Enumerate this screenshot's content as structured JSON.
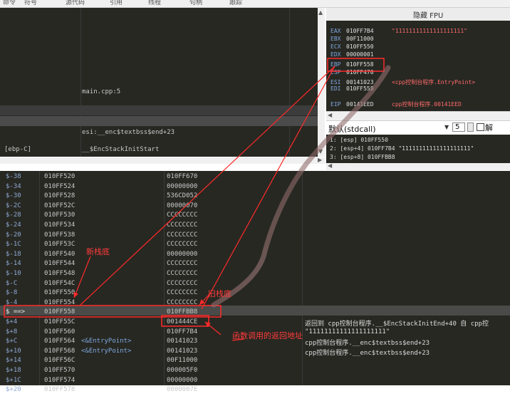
{
  "menubar": [
    "命令",
    "符号",
    "源代码",
    "引用",
    "线程",
    "句柄",
    "跟踪"
  ],
  "disasm": {
    "lines": [
      {
        "col": "",
        "text": "main.cpp:5"
      },
      {
        "col": "",
        "text": "esi:__enc$textbss$end+23"
      },
      {
        "col": "[ebp-C]",
        "text": "__$EncStackInitStart"
      }
    ]
  },
  "registers": {
    "title": "隐藏 FPU",
    "rows": [
      {
        "name": "EAX",
        "value": "010FF7B4",
        "comment": "\"11111111111111111111\""
      },
      {
        "name": "EBX",
        "value": "00F11000",
        "comment": ""
      },
      {
        "name": "ECX",
        "value": "010FF550",
        "comment": ""
      },
      {
        "name": "EDX",
        "value": "00000001",
        "comment": ""
      },
      {
        "name": "EBP",
        "value": "010FF558",
        "comment": ""
      },
      {
        "name": "ESP",
        "value": "010FF470",
        "comment": ""
      },
      {
        "name": "ESI",
        "value": "00141023",
        "comment": "<cpp控制台程序.EntryPoint>"
      },
      {
        "name": "EDI",
        "value": "010FF558",
        "comment": ""
      },
      {
        "name": "EIP",
        "value": "00141EED",
        "comment": "cpp控制台程序.00141EED"
      }
    ]
  },
  "callpane": {
    "convention": "默认(stdcall)",
    "arg_count": "5",
    "checkbox_label": "解",
    "args": [
      "1: [esp] 010FF550",
      "2: [esp+4] 010FF7B4 \"11111111111111111111\"",
      "3: [esp+8] 010FFBB8"
    ]
  },
  "stack": {
    "rows": [
      {
        "off": "$-38",
        "addr": "010FF520",
        "label": "",
        "val": "010FF670",
        "comment": ""
      },
      {
        "off": "$-34",
        "addr": "010FF524",
        "label": "",
        "val": "00000000",
        "comment": ""
      },
      {
        "off": "$-30",
        "addr": "010FF528",
        "label": "",
        "val": "536CD052",
        "comment": ""
      },
      {
        "off": "$-2C",
        "addr": "010FF52C",
        "label": "",
        "val": "00000070",
        "comment": ""
      },
      {
        "off": "$-28",
        "addr": "010FF530",
        "label": "",
        "val": "CCCCCCCC",
        "comment": ""
      },
      {
        "off": "$-24",
        "addr": "010FF534",
        "label": "",
        "val": "CCCCCCCC",
        "comment": ""
      },
      {
        "off": "$-20",
        "addr": "010FF538",
        "label": "",
        "val": "CCCCCCCC",
        "comment": ""
      },
      {
        "off": "$-1C",
        "addr": "010FF53C",
        "label": "",
        "val": "CCCCCCCC",
        "comment": ""
      },
      {
        "off": "$-18",
        "addr": "010FF540",
        "label": "",
        "val": "00000000",
        "comment": ""
      },
      {
        "off": "$-14",
        "addr": "010FF544",
        "label": "",
        "val": "CCCCCCCC",
        "comment": ""
      },
      {
        "off": "$-10",
        "addr": "010FF548",
        "label": "",
        "val": "CCCCCCCC",
        "comment": ""
      },
      {
        "off": "$-C",
        "addr": "010FF54C",
        "label": "",
        "val": "CCCCCCCC",
        "comment": ""
      },
      {
        "off": "$-8",
        "addr": "010FF550",
        "label": "",
        "val": "CCCCCCCC",
        "comment": ""
      },
      {
        "off": "$-4",
        "addr": "010FF554",
        "label": "",
        "val": "CCCCCCCC",
        "comment": ""
      },
      {
        "off": "$ ==>",
        "addr": "010FF558",
        "label": "",
        "val": "010FFBB8",
        "comment": ""
      },
      {
        "off": "$+4",
        "addr": "010FF55C",
        "label": "",
        "val": "001444CE",
        "comment": "返回到 cpp控制台程序.__$EncStackInitEnd+40 自 cpp控"
      },
      {
        "off": "$+8",
        "addr": "010FF560",
        "label": "",
        "val": "010FF7B4",
        "comment": "\"11111111111111111111\""
      },
      {
        "off": "$+C",
        "addr": "010FF564",
        "label": "<&EntryPoint>",
        "val": "00141023",
        "comment": "cpp控制台程序.__enc$textbss$end+23"
      },
      {
        "off": "$+10",
        "addr": "010FF568",
        "label": "<&EntryPoint>",
        "val": "00141023",
        "comment": "cpp控制台程序.__enc$textbss$end+23"
      },
      {
        "off": "$+14",
        "addr": "010FF56C",
        "label": "",
        "val": "00F11000",
        "comment": ""
      },
      {
        "off": "$+18",
        "addr": "010FF570",
        "label": "",
        "val": "000005F0",
        "comment": ""
      },
      {
        "off": "$+1C",
        "addr": "010FF574",
        "label": "",
        "val": "00000000",
        "comment": ""
      },
      {
        "off": "$+20",
        "addr": "010FF578",
        "label": "",
        "val": "0000007E",
        "comment": ""
      }
    ]
  },
  "annotations": {
    "new_stack_bottom": "新栈底",
    "old_stack_bottom": "旧栈底",
    "return_address": "函数调用的返回地址"
  },
  "colors": {
    "annotation": "#ff2a2a",
    "panel_bg": "#272822",
    "register_name": "#7fa8e0"
  }
}
